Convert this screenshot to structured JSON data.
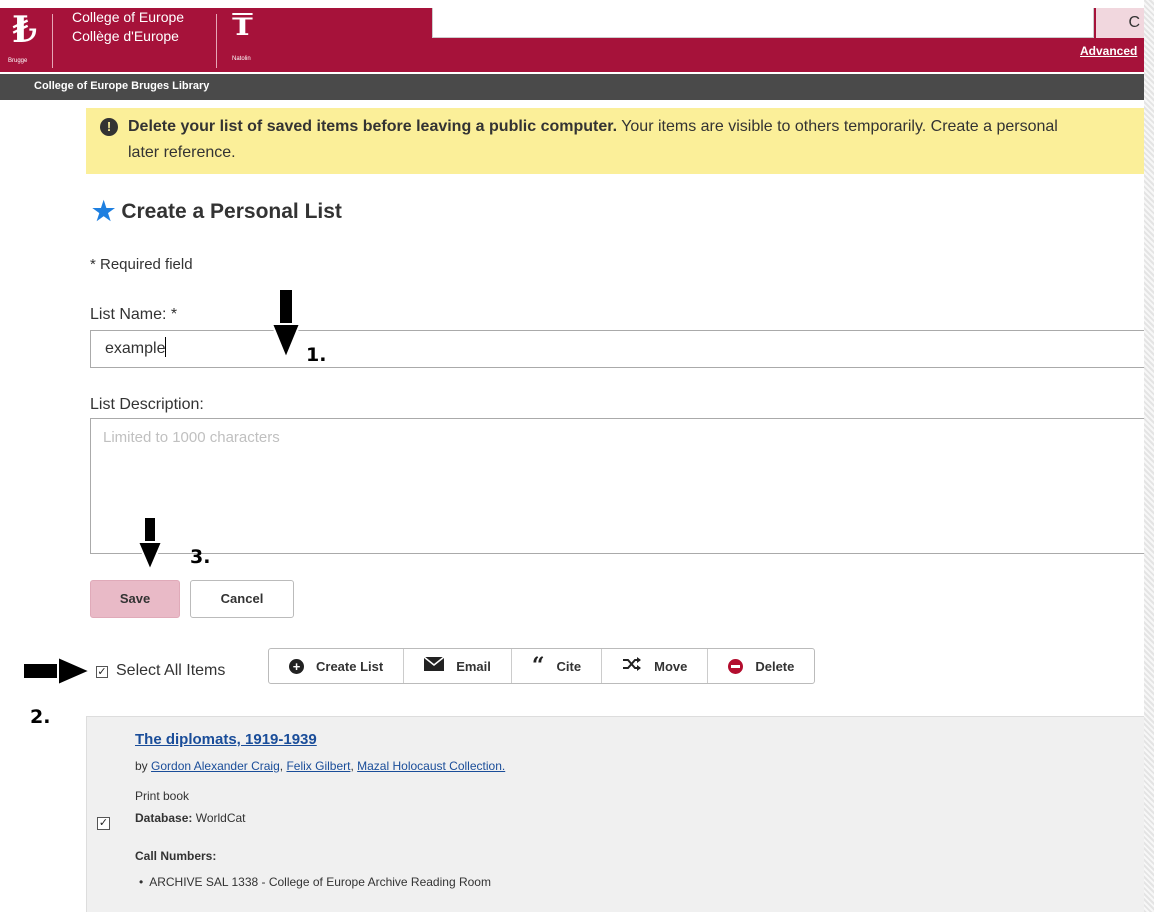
{
  "header": {
    "logo_left_city": "Brugge",
    "college_name_en": "College of Europe",
    "college_name_fr": "Collège d'Europe",
    "logo_right_city": "Natolin",
    "search_button_label": "C",
    "advanced_link": "Advanced",
    "brand_color": "#a6123a"
  },
  "library_bar": {
    "label": "College of Europe Bruges Library"
  },
  "alert": {
    "bold_text": "Delete your list of saved items before leaving a public computer.",
    "text": " Your items are visible to others temporarily. Create a personal",
    "text_line2": "later reference."
  },
  "form": {
    "title": "Create a Personal List",
    "required_note": "* Required field",
    "list_name_label": "List Name: *",
    "list_name_value": "example",
    "list_description_label": "List Description:",
    "list_description_placeholder": "Limited to 1000 characters",
    "save_label": "Save",
    "cancel_label": "Cancel"
  },
  "selection": {
    "select_all_label": "Select All Items",
    "select_all_checked": true
  },
  "toolbar": {
    "buttons": [
      {
        "label": "Create List",
        "icon": "plus-circle-icon"
      },
      {
        "label": "Email",
        "icon": "envelope-icon"
      },
      {
        "label": "Cite",
        "icon": "quote-icon"
      },
      {
        "label": "Move",
        "icon": "shuffle-icon"
      },
      {
        "label": "Delete",
        "icon": "minus-circle-icon"
      }
    ]
  },
  "result": {
    "title": "The diplomats, 1919-1939",
    "by": "by",
    "authors": [
      "Gordon Alexander Craig",
      "Felix Gilbert",
      "Mazal Holocaust Collection."
    ],
    "format": "Print book",
    "database_label": "Database:",
    "database_value": "WorldCat",
    "call_numbers_label": "Call Numbers:",
    "call_numbers": [
      "ARCHIVE SAL 1338 - College of Europe Archive Reading Room"
    ],
    "checked": true
  },
  "annotations": {
    "step1": "1.",
    "step2": "2.",
    "step3": "3."
  }
}
